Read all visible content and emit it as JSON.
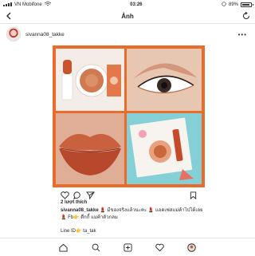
{
  "status": {
    "carrier": "VN Mobifone",
    "time": "03:26",
    "battery": "89%"
  },
  "nav": {
    "title": "Ảnh"
  },
  "post": {
    "username": "sivanna08_takke",
    "likes": "2 lượt thích",
    "caption_user": "sivanna08_takke",
    "caption_text": "💄 มีของจริงแล้วนะคะ 💄 แอดเฟสแม่ค้าไปได้เลย 💄 Fb👉 ดื่กกี้ แม่ค้าตัวกลม",
    "line_id": "Line ID👉 ta_tak"
  },
  "icons": {
    "back": "chevron-left-icon",
    "refresh": "refresh-icon",
    "more": "more-dots-icon",
    "like": "heart-icon",
    "comment": "comment-icon",
    "share": "share-icon",
    "save": "bookmark-icon",
    "tabs": [
      "home-icon",
      "search-icon",
      "add-post-icon",
      "activity-heart-icon",
      "profile-icon"
    ]
  },
  "colors": {
    "accent": "#ea6c2a"
  }
}
